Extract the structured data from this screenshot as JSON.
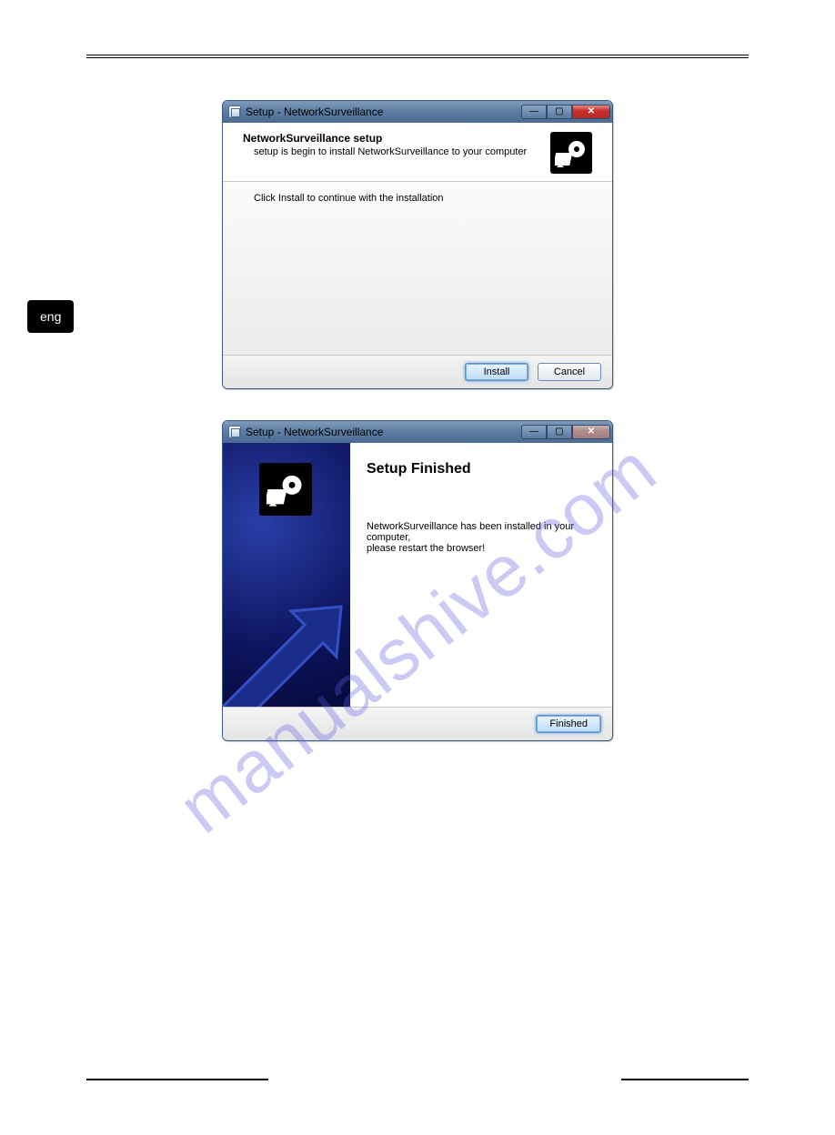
{
  "language_tab": "eng",
  "watermark": "manualshive.com",
  "dialog1": {
    "title": "Setup - NetworkSurveillance",
    "header_title": "NetworkSurveillance setup",
    "header_sub": "setup is begin to install NetworkSurveillance to your computer",
    "body_text": "Click Install to continue with the installation",
    "install_label": "Install",
    "cancel_label": "Cancel",
    "icon_name": "installer-disc-icon",
    "min_icon": "minimize-icon",
    "max_icon": "maximize-icon",
    "close_icon": "close-icon"
  },
  "dialog2": {
    "title": "Setup - NetworkSurveillance",
    "finish_title": "Setup Finished",
    "body_line1": "NetworkSurveillance has been installed in your computer,",
    "body_line2": "please restart the browser!",
    "finished_label": "Finished",
    "icon_name": "installer-disc-icon",
    "min_icon": "minimize-icon",
    "max_icon": "maximize-icon",
    "close_icon": "close-icon"
  }
}
